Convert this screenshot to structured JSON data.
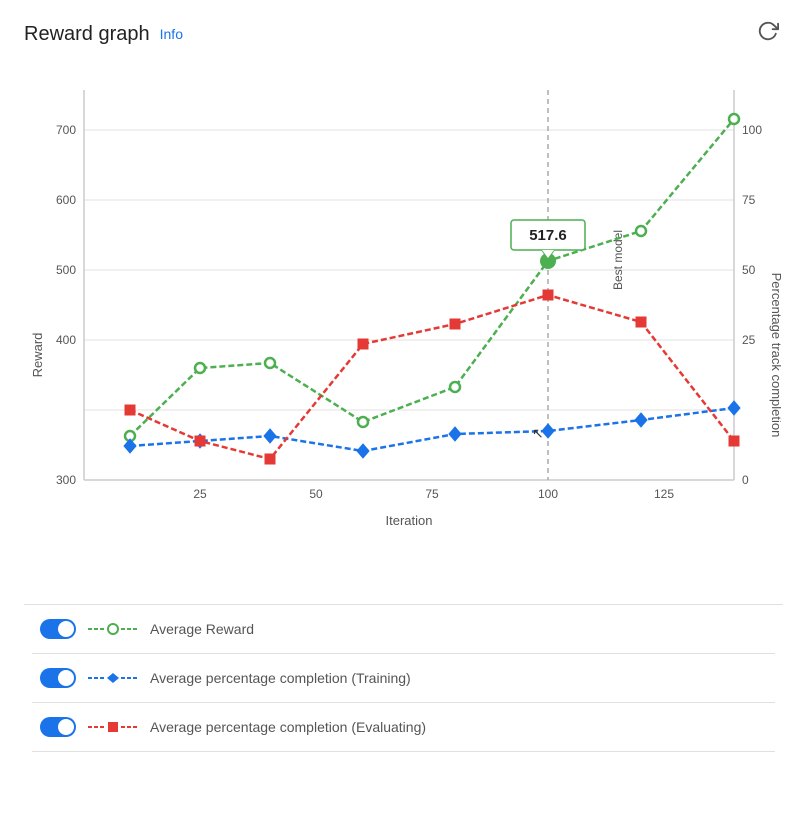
{
  "header": {
    "title": "Reward graph",
    "info_label": "Info",
    "refresh_icon": "refresh-icon"
  },
  "chart": {
    "y_left_label": "Reward",
    "y_right_label": "Percentage track completion",
    "x_label": "Iteration",
    "best_model_label": "Best model",
    "tooltip_value": "517.6",
    "y_left_ticks": [
      "700",
      "600",
      "500",
      "400",
      "300"
    ],
    "y_right_ticks": [
      "100",
      "75",
      "50",
      "25",
      "0"
    ],
    "x_ticks": [
      "25",
      "50",
      "75",
      "100",
      "125"
    ]
  },
  "legend": {
    "items": [
      {
        "id": "avg-reward",
        "label": "Average Reward",
        "color": "#4caf50",
        "marker": "circle",
        "line_style": "dashed"
      },
      {
        "id": "avg-pct-training",
        "label": "Average percentage completion (Training)",
        "color": "#1a73e8",
        "marker": "diamond",
        "line_style": "dashed"
      },
      {
        "id": "avg-pct-evaluating",
        "label": "Average percentage completion (Evaluating)",
        "color": "#e53935",
        "marker": "square",
        "line_style": "dashed"
      }
    ]
  }
}
